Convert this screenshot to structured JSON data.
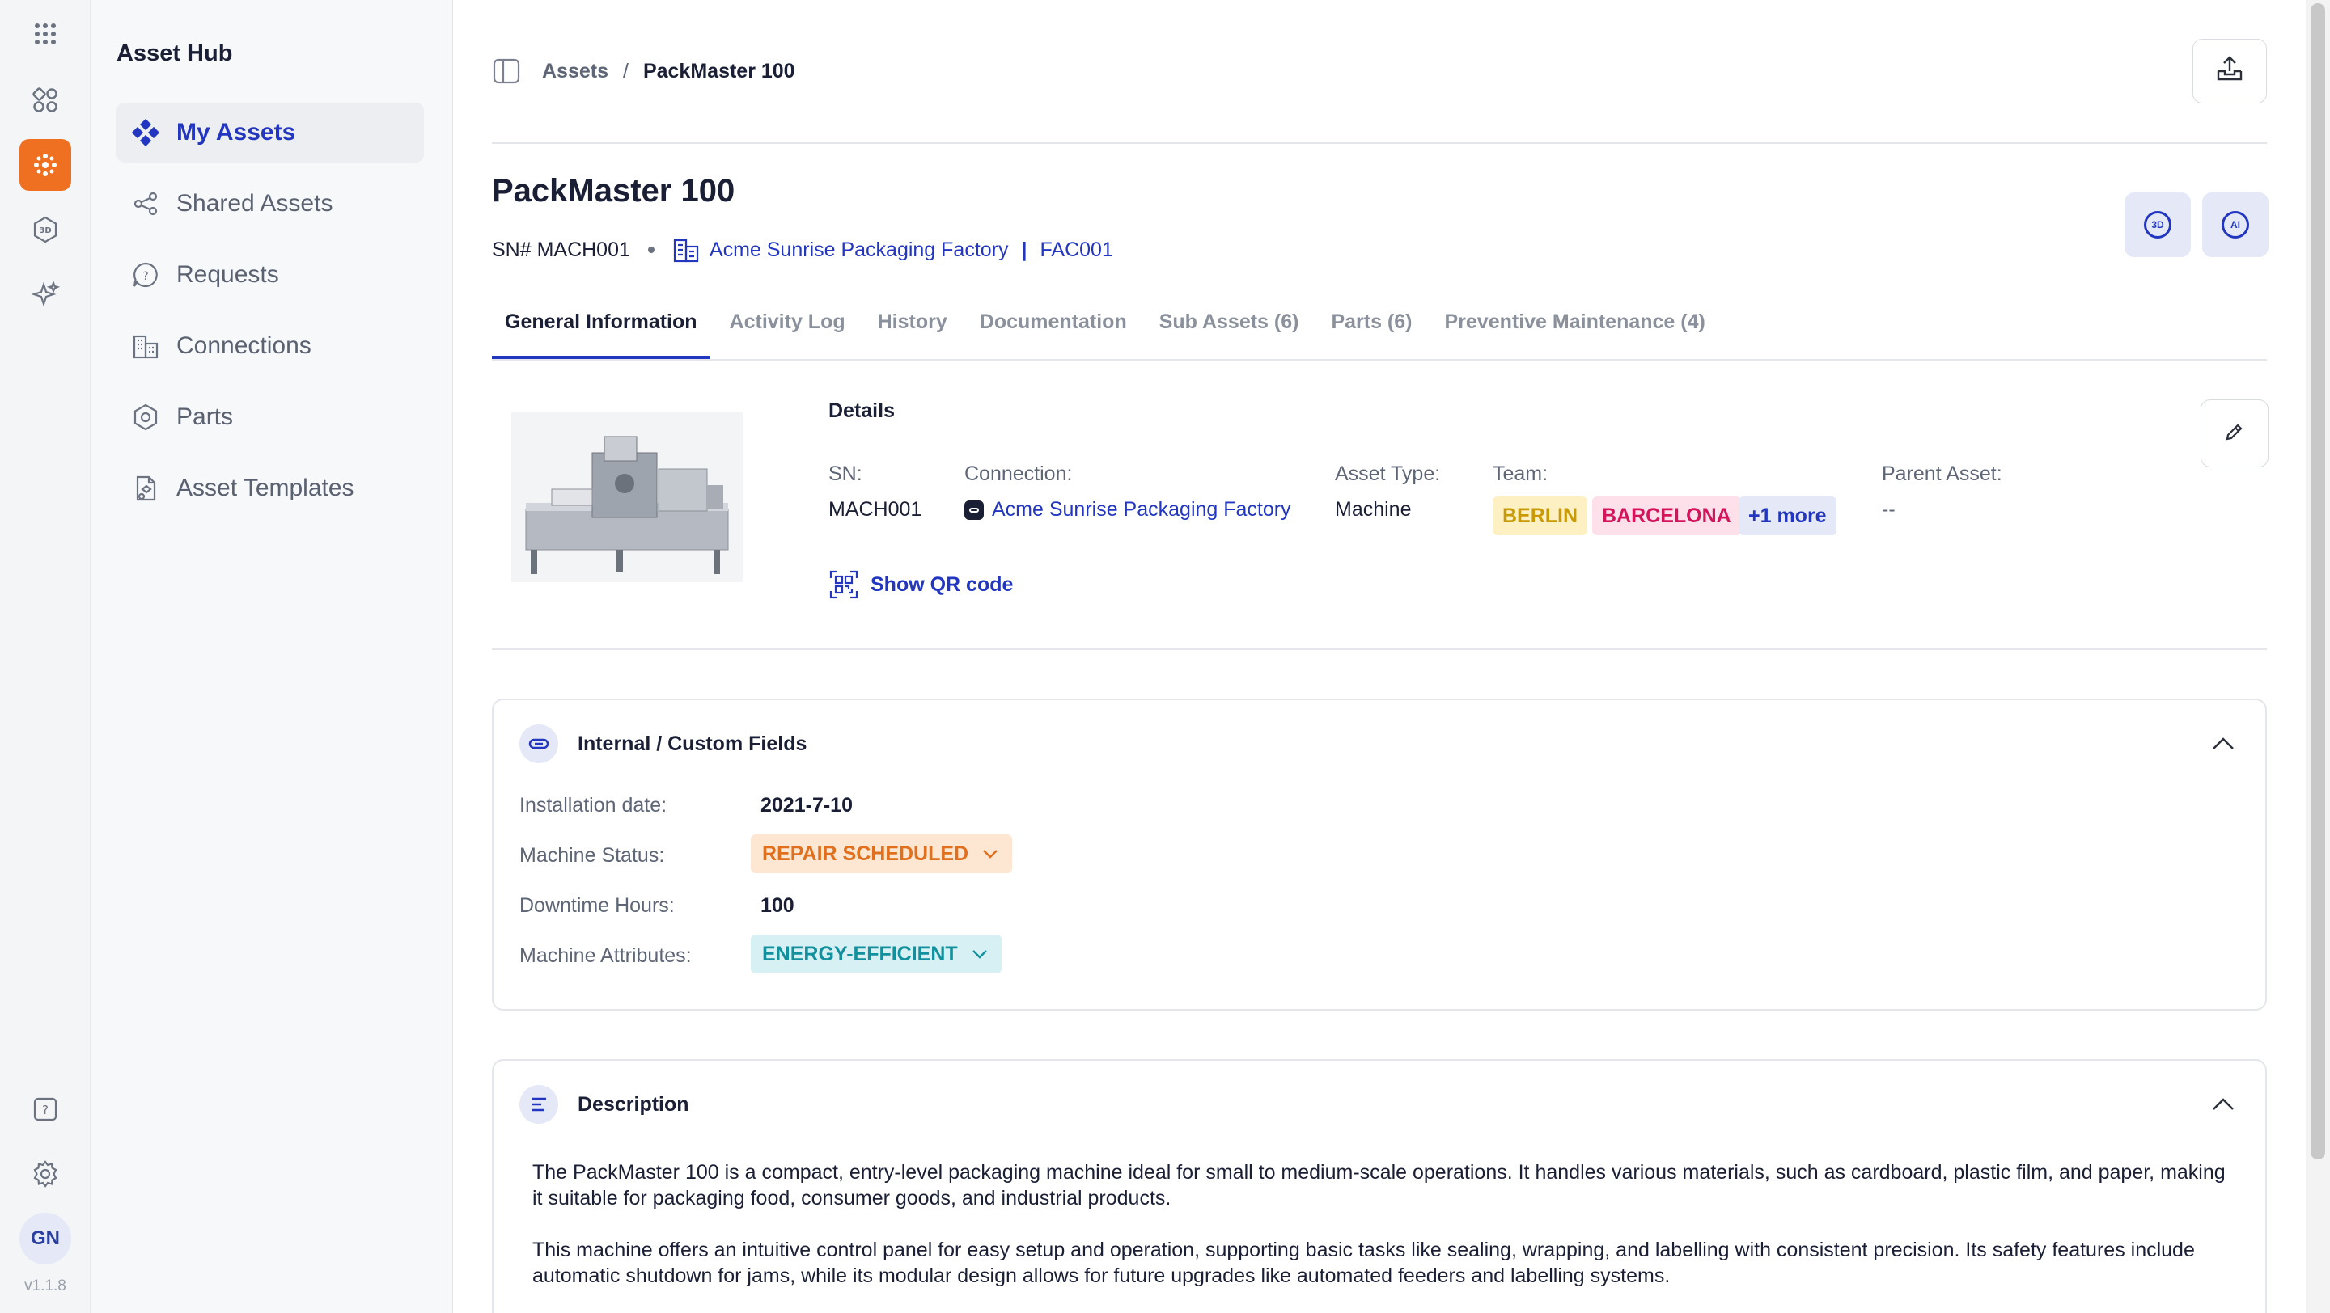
{
  "app": {
    "name": "Asset Hub",
    "version": "v1.1.8",
    "user_initials": "GN"
  },
  "sidebar": {
    "items": [
      {
        "label": "My Assets",
        "icon": "diamond-grid-icon",
        "active": true
      },
      {
        "label": "Shared Assets",
        "icon": "share-icon",
        "active": false
      },
      {
        "label": "Requests",
        "icon": "question-bubble-icon",
        "active": false
      },
      {
        "label": "Connections",
        "icon": "buildings-icon",
        "active": false
      },
      {
        "label": "Parts",
        "icon": "hexagon-nut-icon",
        "active": false
      },
      {
        "label": "Asset Templates",
        "icon": "template-file-icon",
        "active": false
      }
    ]
  },
  "breadcrumb": {
    "parent": "Assets",
    "separator": "/",
    "current": "PackMaster 100"
  },
  "asset": {
    "title": "PackMaster 100",
    "sn_line": "SN# MACH001",
    "connection_name": "Acme Sunrise Packaging Factory",
    "connection_code": "FAC001"
  },
  "tabs": [
    {
      "label": "General Information",
      "active": true
    },
    {
      "label": "Activity Log",
      "active": false
    },
    {
      "label": "History",
      "active": false
    },
    {
      "label": "Documentation",
      "active": false
    },
    {
      "label": "Sub Assets (6)",
      "active": false
    },
    {
      "label": "Parts  (6)",
      "active": false
    },
    {
      "label": "Preventive Maintenance (4)",
      "active": false
    }
  ],
  "header_tiles": {
    "tile_3d": "3D",
    "tile_ai": "AI"
  },
  "details": {
    "title": "Details",
    "sn_label": "SN:",
    "sn_value": "MACH001",
    "connection_label": "Connection:",
    "connection_value": "Acme Sunrise Packaging Factory",
    "asset_type_label": "Asset Type:",
    "asset_type_value": "Machine",
    "team_label": "Team:",
    "teams": [
      "BERLIN",
      "BARCELONA",
      "+1 more"
    ],
    "parent_label": "Parent Asset:",
    "parent_value": "--",
    "qr_label": "Show QR code"
  },
  "custom_fields": {
    "title": "Internal / Custom Fields",
    "rows": [
      {
        "label": "Installation date:",
        "value": "2021-7-10"
      },
      {
        "label": "Machine Status:",
        "value": "REPAIR SCHEDULED"
      },
      {
        "label": "Downtime Hours:",
        "value": "100"
      },
      {
        "label": "Machine Attributes:",
        "value": "ENERGY-EFFICIENT"
      }
    ]
  },
  "description": {
    "title": "Description",
    "paragraphs": [
      "The PackMaster 100 is a compact, entry-level packaging machine ideal for small to medium-scale operations. It handles various materials, such as cardboard, plastic film, and paper, making it suitable for packaging food, consumer goods, and industrial products.",
      "This machine offers an intuitive control panel for easy setup and operation, supporting basic tasks like sealing, wrapping, and labelling with consistent precision. Its safety features include automatic shutdown for jams, while its modular design allows for future upgrades like automated feeders and labelling systems."
    ]
  },
  "colors": {
    "accent": "#2236c0",
    "rail_active": "#f07022",
    "team_berlin_bg": "#fdf1c4",
    "team_berlin_fg": "#c99a06",
    "team_barcelona_bg": "#fde0ea",
    "team_barcelona_fg": "#d4145a",
    "team_more_bg": "#e4e8f7",
    "status_bg": "#fde6d2",
    "status_fg": "#e0701e",
    "attr_bg": "#d6f0f3",
    "attr_fg": "#12909e"
  }
}
